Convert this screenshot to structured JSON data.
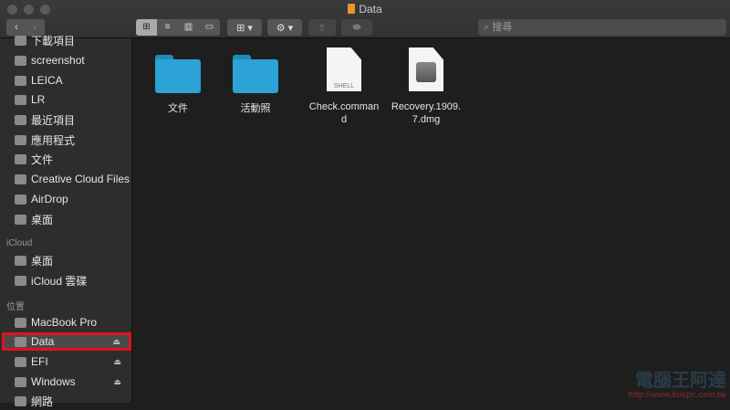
{
  "window": {
    "title": "Data"
  },
  "toolbar": {
    "back": "‹",
    "forward": "›",
    "views": [
      "⊞",
      "≡",
      "▥",
      "▭"
    ],
    "group": "⊞ ▾",
    "action": "⚙ ▾",
    "share": "⇪",
    "tag": "⬬",
    "search_placeholder": "搜尋"
  },
  "sidebar": {
    "favorites": [
      {
        "label": "下載項目",
        "icon": "downloads-icon"
      },
      {
        "label": "screenshot",
        "icon": "folder-icon"
      },
      {
        "label": "LEICA",
        "icon": "folder-icon"
      },
      {
        "label": "LR",
        "icon": "folder-icon"
      },
      {
        "label": "最近項目",
        "icon": "recents-icon"
      },
      {
        "label": "應用程式",
        "icon": "applications-icon"
      },
      {
        "label": "文件",
        "icon": "documents-icon"
      },
      {
        "label": "Creative Cloud Files",
        "icon": "folder-icon"
      },
      {
        "label": "AirDrop",
        "icon": "airdrop-icon"
      },
      {
        "label": "桌面",
        "icon": "desktop-icon"
      }
    ],
    "icloud_header": "iCloud",
    "icloud": [
      {
        "label": "桌面",
        "icon": "desktop-icon"
      },
      {
        "label": "iCloud 雲碟",
        "icon": "cloud-icon"
      }
    ],
    "locations_header": "位置",
    "locations": [
      {
        "label": "MacBook Pro",
        "icon": "laptop-icon",
        "eject": false
      },
      {
        "label": "Data",
        "icon": "disk-icon",
        "eject": true,
        "selected": true
      },
      {
        "label": "EFI",
        "icon": "disk-icon",
        "eject": true
      },
      {
        "label": "Windows",
        "icon": "disk-icon",
        "eject": true
      },
      {
        "label": "網路",
        "icon": "network-icon",
        "eject": false
      }
    ],
    "eject": "⏏"
  },
  "files": [
    {
      "name": "文件",
      "type": "folder"
    },
    {
      "name": "活動照",
      "type": "folder"
    },
    {
      "name": "Check.command",
      "type": "shell",
      "badge": "SHELL"
    },
    {
      "name": "Recovery.1909.7.dmg",
      "type": "dmg"
    }
  ],
  "watermark": {
    "text": "電腦王阿達",
    "url": "http://www.kocpc.com.tw"
  }
}
